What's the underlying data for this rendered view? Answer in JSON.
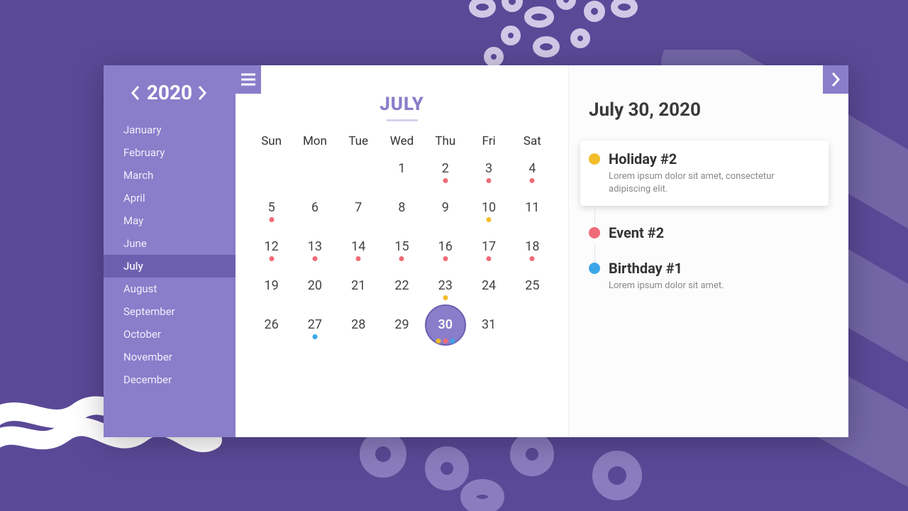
{
  "year": "2020",
  "months": [
    "January",
    "February",
    "March",
    "April",
    "May",
    "June",
    "July",
    "August",
    "September",
    "October",
    "November",
    "December"
  ],
  "active_month_index": 6,
  "month_title": "JULY",
  "weekdays": [
    "Sun",
    "Mon",
    "Tue",
    "Wed",
    "Thu",
    "Fri",
    "Sat"
  ],
  "selected_date_label": "July 30, 2020",
  "colors": {
    "pink": "#f06b78",
    "yellow": "#f2bd2a",
    "blue": "#3aa6e8",
    "purple": "#a08bd8"
  },
  "grid": [
    {
      "n": "",
      "dots": []
    },
    {
      "n": "",
      "dots": []
    },
    {
      "n": "",
      "dots": []
    },
    {
      "n": "1",
      "dots": []
    },
    {
      "n": "2",
      "dots": [
        "pink"
      ]
    },
    {
      "n": "3",
      "dots": [
        "pink"
      ]
    },
    {
      "n": "4",
      "dots": [
        "pink"
      ]
    },
    {
      "n": "5",
      "dots": [
        "pink"
      ]
    },
    {
      "n": "6",
      "dots": []
    },
    {
      "n": "7",
      "dots": []
    },
    {
      "n": "8",
      "dots": []
    },
    {
      "n": "9",
      "dots": []
    },
    {
      "n": "10",
      "dots": [
        "yellow"
      ]
    },
    {
      "n": "11",
      "dots": []
    },
    {
      "n": "12",
      "dots": [
        "pink"
      ]
    },
    {
      "n": "13",
      "dots": [
        "pink"
      ]
    },
    {
      "n": "14",
      "dots": [
        "pink"
      ]
    },
    {
      "n": "15",
      "dots": [
        "pink"
      ]
    },
    {
      "n": "16",
      "dots": [
        "pink"
      ]
    },
    {
      "n": "17",
      "dots": [
        "pink"
      ]
    },
    {
      "n": "18",
      "dots": [
        "pink"
      ]
    },
    {
      "n": "19",
      "dots": []
    },
    {
      "n": "20",
      "dots": []
    },
    {
      "n": "21",
      "dots": []
    },
    {
      "n": "22",
      "dots": []
    },
    {
      "n": "23",
      "dots": [
        "yellow"
      ]
    },
    {
      "n": "24",
      "dots": []
    },
    {
      "n": "25",
      "dots": []
    },
    {
      "n": "26",
      "dots": []
    },
    {
      "n": "27",
      "dots": [
        "blue"
      ]
    },
    {
      "n": "28",
      "dots": []
    },
    {
      "n": "29",
      "dots": []
    },
    {
      "n": "30",
      "dots": [
        "yellow",
        "pink",
        "blue"
      ],
      "selected": true
    },
    {
      "n": "31",
      "dots": []
    }
  ],
  "events": [
    {
      "title": "Holiday #2",
      "desc": "Lorem ipsum dolor sit amet, consectetur adipiscing elit.",
      "color": "yellow",
      "card": true
    },
    {
      "title": "Event #2",
      "desc": "",
      "color": "pink",
      "card": false
    },
    {
      "title": "Birthday #1",
      "desc": "Lorem ipsum dolor sit amet.",
      "color": "blue",
      "card": false
    }
  ]
}
